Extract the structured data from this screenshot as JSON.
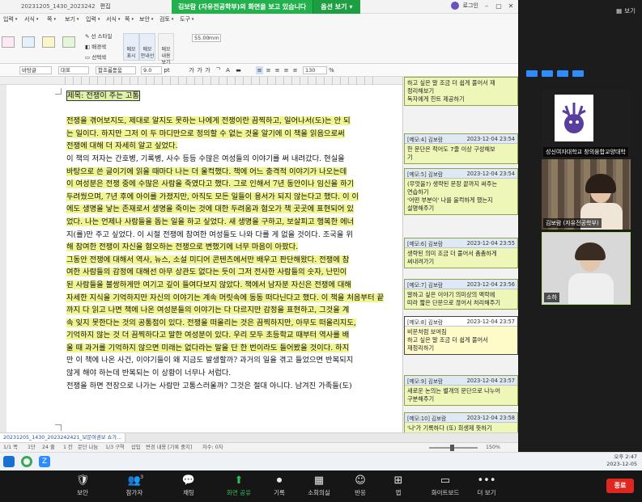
{
  "titlebar": {
    "doc_title": "20231205_1430_2023242",
    "menus": [
      "편집",
      "보기",
      "입력",
      "서식",
      "쪽",
      "보안",
      "검토",
      "도구"
    ],
    "share_notice": "김보람 (자유전공학부)의 화면을 보고 있습니다",
    "share_options": "옵션 보기",
    "login": "로그인",
    "search_placeholder": "찾을 내용"
  },
  "ribbon": {
    "tab_items": [
      "입력",
      "서식",
      "쪽"
    ],
    "note_style": "선 스타일",
    "bg_color": "배경색",
    "select_style": "선택색",
    "memo_show": "메모 표시",
    "memo_guide": "메모 안내선",
    "memo_content": "메모 내용 보기",
    "size_value": "55.00",
    "size_unit": "mm"
  },
  "formatbar": {
    "style": "바탕글",
    "lang": "대표",
    "font": "함초롬돋움",
    "size": "9.0",
    "unit": "pt",
    "bold": "가",
    "italic": "가",
    "underline": "가",
    "line_spacing": "130",
    "percent": "%"
  },
  "document": {
    "lines": [
      {
        "t": "제목: 전쟁이 주는 고통",
        "hl": "title"
      },
      {
        "t": "",
        "hl": "none"
      },
      {
        "t": "  전쟁을 겪어보지도, 제대로 알지도 못하는 나에게 전쟁이란 끔찍하고, 일어나서(도)는 안 되",
        "hl": "yellow"
      },
      {
        "t": "는 일이다. 하지만 그저 이 두 마디만으로 정의할 수 없는 것을 알기에 이 책을 읽음으로써",
        "hl": "part"
      },
      {
        "t": "전쟁에 대해 더 자세히 알고 싶었다.",
        "hl": "tail"
      },
      {
        "t": "  이 책의 저자는 간호병, 기록병, 사수 등등 수많은 여성들의 이야기를 써 내려갔다. 현실을",
        "hl": "none"
      },
      {
        "t": "바탕으로 쓴 글이기에 읽을 때마다 나는 더 울컥했다. 책에 어느 충격적 이야기가 나오는데",
        "hl": "part2"
      },
      {
        "t": "이 여성분은 전쟁 중에 수많은 사람을 죽였다고 했다. 그로 인해서 7년 동안이나 임신을 하기",
        "hl": "yellow"
      },
      {
        "t": "두려웠으며, 7년 후에 아이를 가졌지만, 아직도 모든 일들이 용서가 되지 않는다고 했다. 이 이",
        "hl": "yellow"
      },
      {
        "t": "에도 생명을 낳는 존재로서 생명을 죽이는 것에 대한 두려움과 혐오가 책 곳곳에 표현되어 있",
        "hl": "yellow"
      },
      {
        "t": "었다. 나는 언제나 사람들을 돕는 일을 하고 싶었다. 새 생명을 구하고, 보살피고 행복한 에너",
        "hl": "lead"
      },
      {
        "t": "지(를)만 주고 싶었다. 이 시절 전쟁에 참여한 여성들도 나와 다를 게 없을 것이다. 조국을 위",
        "hl": "none"
      },
      {
        "t": "해 참여한 전쟁이 자신을 혐오하는 전쟁으로 변했기에 너무 마음이 아팠다.",
        "hl": "tail2"
      },
      {
        "t": "  그동안 전쟁에 대해서 역사, 뉴스, 소설 미디어 콘텐츠에서만 배우고 판단해왔다. 전쟁에 참",
        "hl": "part3"
      },
      {
        "t": "여한 사람들의 감정에 대해선 아무 상관도 없다는 듯이 그저 전사한 사람들의 숫자, 난민이",
        "hl": "yellow"
      },
      {
        "t": "된 사람들을 불쌍하게만 여기고 깊이 들여다보지 않았다. 책에서 남자분 자신은 전쟁에 대해",
        "hl": "yellow"
      },
      {
        "t": "자세한 지식을 기억하지만 자신의 이야기는 계속 머릿속에 동동 떠다닌다고 했다. 이 책을 처음부터 끝",
        "hl": "yellow"
      },
      {
        "t": "까지 다 읽고 나면 책에 나온 여성분들의 이야기는 다 다르지만 감정을 표현하고, 그것을 계",
        "hl": "yellow"
      },
      {
        "t": "속 잊지 못한다는 것의 공통점이 있다. 전쟁을 떠올리는 것은 끔찍하지만, 아무도 떠올리지도,",
        "hl": "yellow"
      },
      {
        "t": "기억하지 않는 것 더 끔찍하다고 말한 여성분이 있다. 우리 모두 초등학교 때부터 역사를 배",
        "hl": "part4"
      },
      {
        "t": "울 때 과거를 기억하지 않으면 미래는 없다라는 말을 단 한 번이라도 들어봤을 것이다. 하지",
        "hl": "part5"
      },
      {
        "t": "만 이 책에 나온 사건, 이야기들이 왜 지금도 발생할까? 과거의 일을 겪고 들었으면 반복되지",
        "hl": "none"
      },
      {
        "t": "않게 해야 하는데 반복되는 이 상황이 너무나 서럽다.",
        "hl": "none"
      },
      {
        "t": "  전쟁을 하면 전장으로 나가는 사람만 고통스러울까? 그것은 절대 아니다. 남겨진 가족들(도)",
        "hl": "none"
      }
    ]
  },
  "memos": [
    {
      "head_left": "",
      "head_right": "",
      "body": [
        "하고 싶은 말 조금 더 쉽게 풀어서 재",
        "정리해보기",
        "독자에게 힌트 제공하기"
      ]
    },
    {
      "head_left": "[메모:4] 김보람",
      "head_right": "2023-12-04 23:54",
      "body": [
        "한 문단은 적어도 7줄 이상 구성해보",
        "기"
      ]
    },
    {
      "head_left": "[메모:5] 김보람",
      "head_right": "2023-12-04 23:54",
      "body": [
        "(무엇을?) 생략된 문장 끝까지 써주는",
        "연습하기",
        "'어떤 부분이' 나를 울컥하게 했는지",
        "설명해주기"
      ]
    },
    {
      "head_left": "[메모:6] 김보람",
      "head_right": "2023-12-04 23:55",
      "body": [
        "생략된 의미 조금 더 풀어서 촘촘하게",
        "써내려가기"
      ]
    },
    {
      "head_left": "[메모:7] 김보람",
      "head_right": "2023-12-04 23:56",
      "body": [
        "말하고 싶은 이야기 의미상의 맥락에",
        "따라 짧은 단문으로 끊어서 처리해주기"
      ]
    },
    {
      "head_left": "[메모:8] 김보람",
      "head_right": "2023-12-04 23:57",
      "body": [
        "비문처럼 보여짐",
        "하고 싶은 말 조금 더 쉽게 풀어서",
        "재정리하기"
      ]
    },
    {
      "head_left": "[메모:9] 김보람",
      "head_right": "2023-12-04 23:57",
      "body": [
        "새로운 논의는 별개의 문단으로 나누어",
        "구분해주기"
      ]
    },
    {
      "head_left": "[메모:10] 김보람",
      "head_right": "2023-12-04 23:58",
      "body": [
        "'나'가 기록하다 (또) 희생제 뜻하기"
      ]
    }
  ],
  "tabs": {
    "doc_tab": "20231205_1430_2023242421_보문여권보 쇼가..."
  },
  "status": {
    "items": [
      "1/1 쪽",
      "1단",
      "24 줄",
      "1 칸",
      "문단 나눔",
      "1/3 구역",
      "삽입",
      "변경 내용 [기록 중지]",
      "자수: 0자"
    ],
    "zoom": "150%"
  },
  "taskbar": {
    "time": "오후 2:47",
    "date": "2023-12-05"
  },
  "zoom_side": {
    "view_label": "보기",
    "tile1_name": "성신여자대학교 창의융합교양대학",
    "tile2_name": "김보람 (자유전공학부)",
    "tile3_name": "소하"
  },
  "zoombar": {
    "items": [
      {
        "label": "보안",
        "glyph": "🛡"
      },
      {
        "label": "참가자",
        "glyph": "👥",
        "count": "3"
      },
      {
        "label": "채팅",
        "glyph": "💬"
      },
      {
        "label": "화면 공유",
        "glyph": "⬆"
      },
      {
        "label": "기록",
        "glyph": "⏺"
      },
      {
        "label": "소회의실",
        "glyph": "▦"
      },
      {
        "label": "반응",
        "glyph": "☺"
      },
      {
        "label": "앱",
        "glyph": "⊞"
      },
      {
        "label": "화이트보드",
        "glyph": "▭"
      },
      {
        "label": "더 보기",
        "glyph": "•••"
      }
    ],
    "end_label": "종료"
  },
  "colors": {
    "highlight_yellow": "#f0f590",
    "memo_bg": "#eef6b8",
    "share_green": "#22b14c",
    "end_red": "#e0271f"
  }
}
